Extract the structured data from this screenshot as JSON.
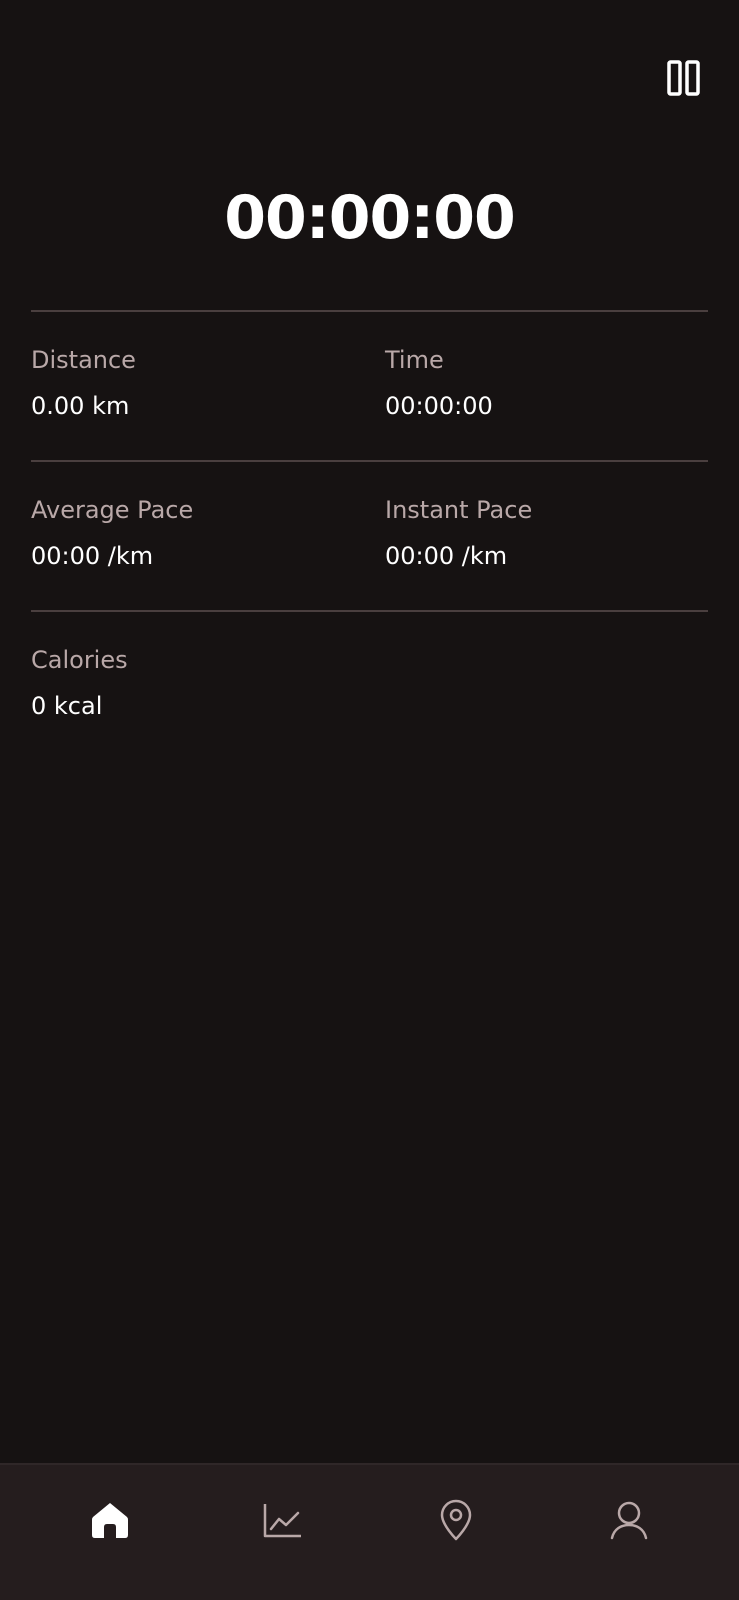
{
  "timer": {
    "display": "00:00:00"
  },
  "controls": {
    "pause_icon": "pause-icon"
  },
  "stats": {
    "distance": {
      "label": "Distance",
      "value": "0.00 km"
    },
    "time": {
      "label": "Time",
      "value": "00:00:00"
    },
    "average_pace": {
      "label": "Average Pace",
      "value": "00:00 /km"
    },
    "instant_pace": {
      "label": "Instant Pace",
      "value": "00:00 /km"
    },
    "calories": {
      "label": "Calories",
      "value": "0 kcal"
    }
  },
  "bottom_nav": {
    "items": [
      {
        "icon": "home-icon",
        "active": true
      },
      {
        "icon": "chart-icon",
        "active": false
      },
      {
        "icon": "map-pin-icon",
        "active": false
      },
      {
        "icon": "user-icon",
        "active": false
      }
    ]
  },
  "colors": {
    "background": "#161212",
    "nav_background": "#251d1e",
    "divider": "#4a3f3f",
    "label": "#b9a8a8",
    "value": "#ffffff",
    "nav_active": "#ffffff",
    "nav_inactive": "#b9a8a8"
  }
}
